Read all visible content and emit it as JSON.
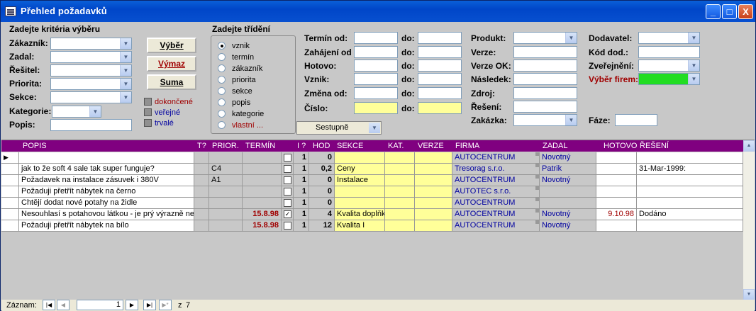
{
  "window": {
    "title": "Přehled požadavků",
    "min": "_",
    "max": "□",
    "close": "X"
  },
  "criteria": {
    "title": "Zadejte kritéria výběru",
    "zakaznik": "Zákazník:",
    "zadal": "Zadal:",
    "resitel": "Řešitel:",
    "priorita": "Priorita:",
    "sekce": "Sekce:",
    "kategorie": "Kategorie:",
    "popis": "Popis:"
  },
  "buttons": {
    "vyber": "Výběr",
    "vymaz": "Výmaz",
    "suma": "Suma"
  },
  "checks": {
    "dokoncene": "dokončené",
    "verejne": "veřejné",
    "trvale": "trvalé"
  },
  "sort": {
    "title": "Zadejte třídění",
    "options": [
      "vznik",
      "termín",
      "zákazník",
      "priorita",
      "sekce",
      "popis",
      "kategorie",
      "vlastní ..."
    ],
    "order": "Sestupně"
  },
  "dates": {
    "termin": "Termín od:",
    "zahajeni": "Zahájení od",
    "hotovo": "Hotovo:",
    "vznik": "Vznik:",
    "zmena": "Změna od:",
    "cislo": "Číslo:",
    "do": "do:"
  },
  "product": {
    "produkt": "Produkt:",
    "verze": "Verze:",
    "verze_ok": "Verze OK:",
    "nasledek": "Následek:",
    "zdroj": "Zdroj:",
    "reseni": "Řešení:",
    "zakazka": "Zakázka:"
  },
  "supplier": {
    "dodavatel": "Dodavatel:",
    "kod": "Kód dod.:",
    "zverejneni": "Zveřejnění:",
    "vyber_firem": "Výběr firem:",
    "faze": "Fáze:"
  },
  "grid": {
    "headers": {
      "popis": "POPIS",
      "t": "T?",
      "prior": "PRIOR.",
      "termin": "TERMÍN",
      "i": "I ?",
      "hod": "HOD",
      "sekce": "SEKCE",
      "kat": "KAT.",
      "verze": "VERZE",
      "firma": "FIRMA",
      "zadal": "ZADAL",
      "hotovo": "HOTOVO",
      "reseni": "ŘEŠENÍ"
    },
    "rows": [
      {
        "popis": "",
        "prior": "",
        "termin": "",
        "chk": "",
        "one": "1",
        "hod": "0",
        "sekce": "",
        "firma": "AUTOCENTRUM",
        "zadal": "Novotný",
        "hotovo": "",
        "reseni": ""
      },
      {
        "popis": "jak to že soft 4 sale tak super funguje?",
        "prior": "C4",
        "termin": "",
        "chk": "",
        "one": "1",
        "hod": "0,2",
        "sekce": "Ceny",
        "firma": "Tresorag s.r.o.",
        "zadal": "Patrik",
        "hotovo": "",
        "reseni": "31-Mar-1999:"
      },
      {
        "popis": "Požadavek na instalace zásuvek i 380V",
        "prior": "A1",
        "termin": "",
        "chk": "",
        "one": "1",
        "hod": "0",
        "sekce": "Instalace",
        "firma": "AUTOCENTRUM",
        "zadal": "Novotný",
        "hotovo": "",
        "reseni": ""
      },
      {
        "popis": "Požaduji přetřít nábytek na černo",
        "prior": "",
        "termin": "",
        "chk": "",
        "one": "1",
        "hod": "0",
        "sekce": "",
        "firma": "AUTOTEC s.r.o.",
        "zadal": "",
        "hotovo": "",
        "reseni": ""
      },
      {
        "popis": "Chtějí dodat nové potahy na židle",
        "prior": "",
        "termin": "",
        "chk": "",
        "one": "1",
        "hod": "0",
        "sekce": "",
        "firma": "AUTOCENTRUM",
        "zadal": "",
        "hotovo": "",
        "reseni": ""
      },
      {
        "popis": "Nesouhlasí s potahovou látkou - je prý výrazně ne",
        "prior": "",
        "termin": "15.8.98",
        "chk": "✓",
        "one": "1",
        "hod": "4",
        "sekce": "Kvalita doplňk",
        "firma": "AUTOCENTRUM",
        "zadal": "Novotný",
        "hotovo": "9.10.98",
        "reseni": "Dodáno"
      },
      {
        "popis": "Požaduji přetřít nábytek na bílo",
        "prior": "",
        "termin": "15.8.98",
        "chk": "",
        "one": "1",
        "hod": "12",
        "sekce": "Kvalita I",
        "firma": "AUTOCENTRUM",
        "zadal": "Novotný",
        "hotovo": "",
        "reseni": ""
      }
    ]
  },
  "status": {
    "zaznam": "Záznam:",
    "current": "1",
    "of": "z",
    "total": "7"
  }
}
